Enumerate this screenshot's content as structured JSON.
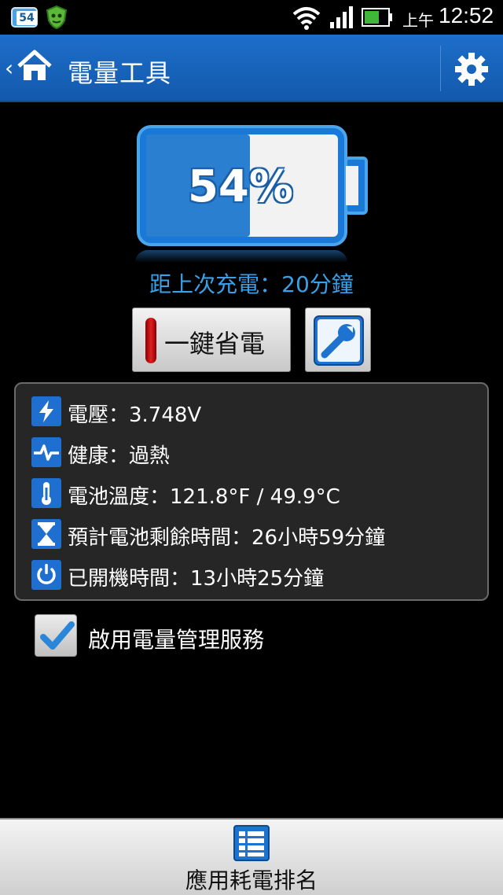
{
  "status_bar": {
    "badge": "54",
    "ampm": "上午",
    "time": "12:52"
  },
  "action_bar": {
    "back_glyph": "‹",
    "title": "電量工具"
  },
  "battery": {
    "percent_text": "54%",
    "level": 0.54,
    "since_last_charge": "距上次充電：20分鐘"
  },
  "buttons": {
    "one_click_save": "一鍵省電"
  },
  "info": {
    "voltage": "電壓：3.748V",
    "health": "健康：過熱",
    "temperature": "電池溫度：121.8°F / 49.9°C",
    "remaining": "預計電池剩餘時間：26小時59分鐘",
    "uptime": "已開機時間：13小時25分鐘"
  },
  "service": {
    "enabled": true,
    "label": "啟用電量管理服務"
  },
  "bottom": {
    "label": "應用耗電排名"
  },
  "colors": {
    "accent": "#1d6ec9",
    "link_blue": "#3aa0e8",
    "panel": "#262626"
  }
}
